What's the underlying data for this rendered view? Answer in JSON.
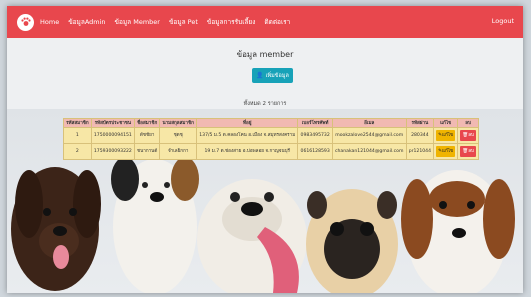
{
  "nav": {
    "items": [
      "Home",
      "ข้อมูลAdmin",
      "ข้อมูล Member",
      "ข้อมูล Pet",
      "ข้อมูลการรับเลี้ยง",
      "ติดต่อเรา"
    ],
    "logout": "Logout"
  },
  "page": {
    "title": "ข้อมูล member",
    "add_label": "เพิ่มข้อมูล",
    "count": "ทั้งหมด 2 รายการ"
  },
  "table": {
    "headers": [
      "รหัสสมาชิก",
      "รหัสบัตรประชาชน",
      "ชื่อสมาชิก",
      "นามสกุลสมาชิก",
      "ที่อยู่",
      "เบอร์โทรศัพท์",
      "อีเมล",
      "รหัสผ่าน",
      "แก้ไข",
      "ลบ"
    ],
    "rows": [
      [
        "1",
        "1750000094151",
        "ดัชชัยา",
        "ชุดชุ",
        "137/5 ม.5 ต.คลองโคน อ.เมือง จ.สมุทรสงคราม",
        "0983495732",
        "mookzalove2544@gmail.com",
        "280344"
      ],
      [
        "2",
        "1759300093222",
        "ชนากานต์",
        "จำเลยิกกา",
        "19 ม.7 ต.ช่องสาย อ.บ่อพลอย จ.กาญจนบุรี",
        "0616128593",
        "chanakan121044@gmail.com",
        "pr121044"
      ]
    ],
    "edit_label": "แก้ไข",
    "delete_label": "ลบ"
  },
  "colors": {
    "navbar": "#e8474d",
    "add_button": "#17a2b8",
    "edit_button": "#f0b400",
    "delete_button": "#e8474d",
    "row_bg": "#f7e7a6",
    "header_bg": "#f1b9b2"
  }
}
